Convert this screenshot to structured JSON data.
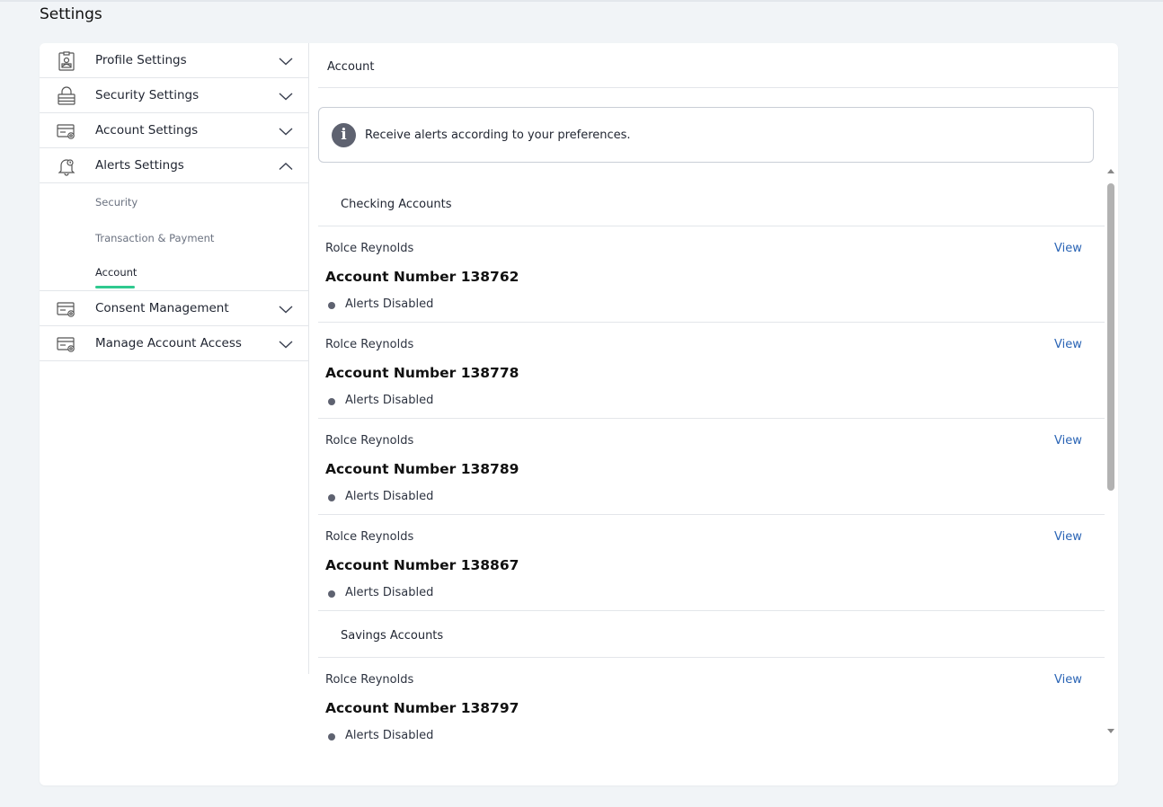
{
  "page": {
    "title": "Settings"
  },
  "sidebar": {
    "items": [
      {
        "label": "Profile Settings",
        "icon": "profile-badge-icon",
        "expanded": false
      },
      {
        "label": "Security Settings",
        "icon": "lock-icon",
        "expanded": false
      },
      {
        "label": "Account Settings",
        "icon": "account-settings-icon",
        "expanded": false
      },
      {
        "label": "Alerts Settings",
        "icon": "bell-icon",
        "expanded": true
      },
      {
        "label": "Consent Management",
        "icon": "account-settings-icon",
        "expanded": false
      },
      {
        "label": "Manage Account Access",
        "icon": "account-settings-icon",
        "expanded": false
      }
    ],
    "alerts_sub": [
      {
        "label": "Security"
      },
      {
        "label": "Transaction & Payment"
      },
      {
        "label": "Account",
        "active": true
      }
    ]
  },
  "main": {
    "title": "Account",
    "banner": "Receive alerts according to your preferences.",
    "sections": [
      {
        "label": "Checking Accounts",
        "accounts": [
          {
            "name": "Rolce Reynolds",
            "number": "Account Number 138762",
            "status": "Alerts Disabled",
            "action": "View"
          },
          {
            "name": "Rolce Reynolds",
            "number": "Account Number 138778",
            "status": "Alerts Disabled",
            "action": "View"
          },
          {
            "name": "Rolce Reynolds",
            "number": "Account Number 138789",
            "status": "Alerts Disabled",
            "action": "View"
          },
          {
            "name": "Rolce Reynolds",
            "number": "Account Number 138867",
            "status": "Alerts Disabled",
            "action": "View"
          }
        ]
      },
      {
        "label": "Savings Accounts",
        "accounts": [
          {
            "name": "Rolce Reynolds",
            "number": "Account Number 138797",
            "status": "Alerts Disabled",
            "action": "View"
          }
        ]
      }
    ]
  },
  "colors": {
    "accent": "#2fc98f",
    "link": "#2a64b5",
    "status_dot": "#5e6270"
  }
}
